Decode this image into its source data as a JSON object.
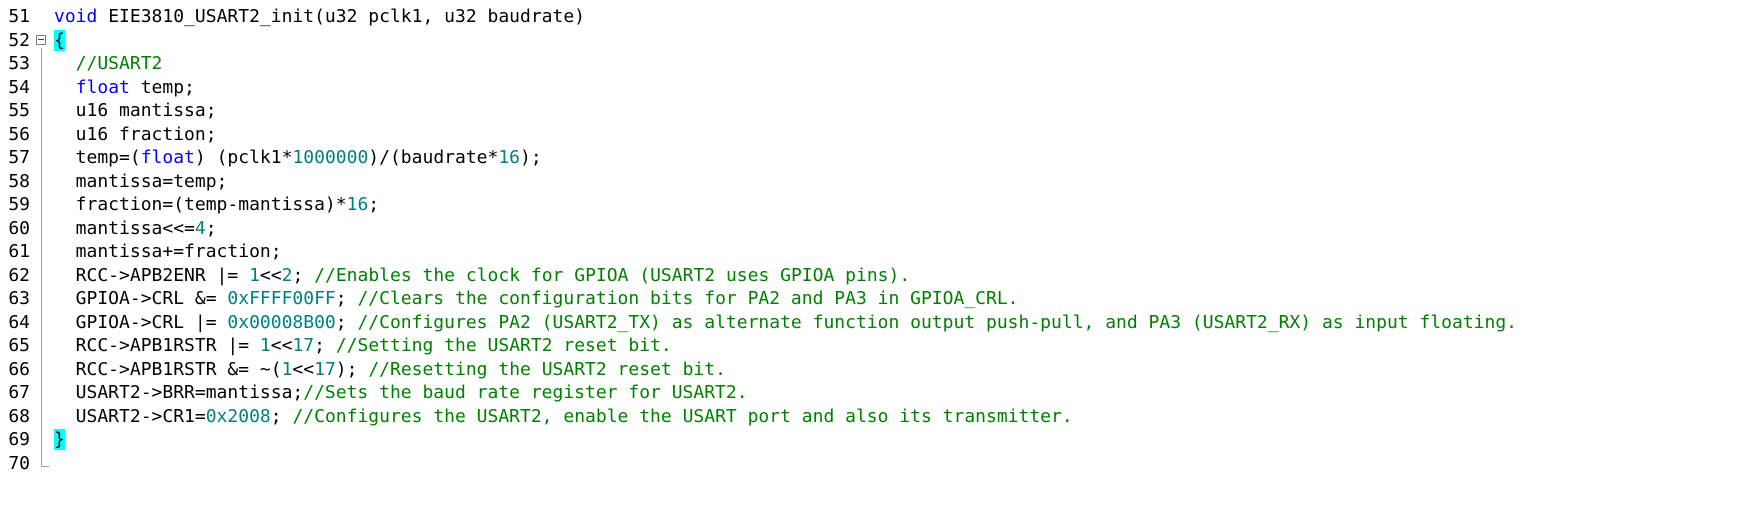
{
  "lines": [
    {
      "n": "51",
      "parts": [
        {
          "t": "void",
          "c": "kw"
        },
        {
          "t": " EIE3810_USART2_init(u32 pclk1, u32 baudrate)",
          "c": ""
        }
      ]
    },
    {
      "n": "52",
      "parts": [
        {
          "t": "{",
          "c": "brace"
        }
      ]
    },
    {
      "n": "53",
      "parts": [
        {
          "t": "  //USART2",
          "c": "cm"
        }
      ]
    },
    {
      "n": "54",
      "parts": [
        {
          "t": "  ",
          "c": ""
        },
        {
          "t": "float",
          "c": "kw"
        },
        {
          "t": " temp;",
          "c": ""
        }
      ]
    },
    {
      "n": "55",
      "parts": [
        {
          "t": "  u16 mantissa;",
          "c": ""
        }
      ]
    },
    {
      "n": "56",
      "parts": [
        {
          "t": "  u16 fraction;",
          "c": ""
        }
      ]
    },
    {
      "n": "57",
      "parts": [
        {
          "t": "  temp=(",
          "c": ""
        },
        {
          "t": "float",
          "c": "kw"
        },
        {
          "t": ") (pclk1*",
          "c": ""
        },
        {
          "t": "1000000",
          "c": "num"
        },
        {
          "t": ")/(baudrate*",
          "c": ""
        },
        {
          "t": "16",
          "c": "num"
        },
        {
          "t": ");",
          "c": ""
        }
      ]
    },
    {
      "n": "58",
      "parts": [
        {
          "t": "  mantissa=temp;",
          "c": ""
        }
      ]
    },
    {
      "n": "59",
      "parts": [
        {
          "t": "  fraction=(temp-mantissa)*",
          "c": ""
        },
        {
          "t": "16",
          "c": "num"
        },
        {
          "t": ";",
          "c": ""
        }
      ]
    },
    {
      "n": "60",
      "parts": [
        {
          "t": "  mantissa<<=",
          "c": ""
        },
        {
          "t": "4",
          "c": "num"
        },
        {
          "t": ";",
          "c": ""
        }
      ]
    },
    {
      "n": "61",
      "parts": [
        {
          "t": "  mantissa+=fraction;",
          "c": ""
        }
      ]
    },
    {
      "n": "62",
      "parts": [
        {
          "t": "  RCC->APB2ENR |= ",
          "c": ""
        },
        {
          "t": "1",
          "c": "num"
        },
        {
          "t": "<<",
          "c": ""
        },
        {
          "t": "2",
          "c": "num"
        },
        {
          "t": "; ",
          "c": ""
        },
        {
          "t": "//Enables the clock for GPIOA (USART2 uses GPIOA pins).",
          "c": "cm"
        }
      ]
    },
    {
      "n": "63",
      "parts": [
        {
          "t": "  GPIOA->CRL &= ",
          "c": ""
        },
        {
          "t": "0xFFFF00FF",
          "c": "num"
        },
        {
          "t": "; ",
          "c": ""
        },
        {
          "t": "//Clears the configuration bits for PA2 and PA3 in GPIOA_CRL.",
          "c": "cm"
        }
      ]
    },
    {
      "n": "64",
      "parts": [
        {
          "t": "  GPIOA->CRL |= ",
          "c": ""
        },
        {
          "t": "0x00008B00",
          "c": "num"
        },
        {
          "t": "; ",
          "c": ""
        },
        {
          "t": "//Configures PA2 (USART2_TX) as alternate function output push-pull, and PA3 (USART2_RX) as input floating.",
          "c": "cm"
        }
      ]
    },
    {
      "n": "65",
      "parts": [
        {
          "t": "  RCC->APB1RSTR |= ",
          "c": ""
        },
        {
          "t": "1",
          "c": "num"
        },
        {
          "t": "<<",
          "c": ""
        },
        {
          "t": "17",
          "c": "num"
        },
        {
          "t": "; ",
          "c": ""
        },
        {
          "t": "//Setting the USART2 reset bit.",
          "c": "cm"
        }
      ]
    },
    {
      "n": "66",
      "parts": [
        {
          "t": "  RCC->APB1RSTR &= ~(",
          "c": ""
        },
        {
          "t": "1",
          "c": "num"
        },
        {
          "t": "<<",
          "c": ""
        },
        {
          "t": "17",
          "c": "num"
        },
        {
          "t": "); ",
          "c": ""
        },
        {
          "t": "//Resetting the USART2 reset bit.",
          "c": "cm"
        }
      ]
    },
    {
      "n": "67",
      "parts": [
        {
          "t": "  USART2->BRR=mantissa;",
          "c": ""
        },
        {
          "t": "//Sets the baud rate register for USART2.",
          "c": "cm"
        }
      ]
    },
    {
      "n": "68",
      "parts": [
        {
          "t": "  USART2->CR1=",
          "c": ""
        },
        {
          "t": "0x2008",
          "c": "num"
        },
        {
          "t": "; ",
          "c": ""
        },
        {
          "t": "//Configures the USART2, enable the USART port and also its transmitter.",
          "c": "cm"
        }
      ]
    },
    {
      "n": "69",
      "parts": [
        {
          "t": "}",
          "c": "brace"
        }
      ]
    },
    {
      "n": "70",
      "parts": []
    }
  ],
  "colors": {
    "keyword": "#0000ff",
    "number": "#008080",
    "comment": "#008000",
    "brace_match": "#00ffff"
  }
}
